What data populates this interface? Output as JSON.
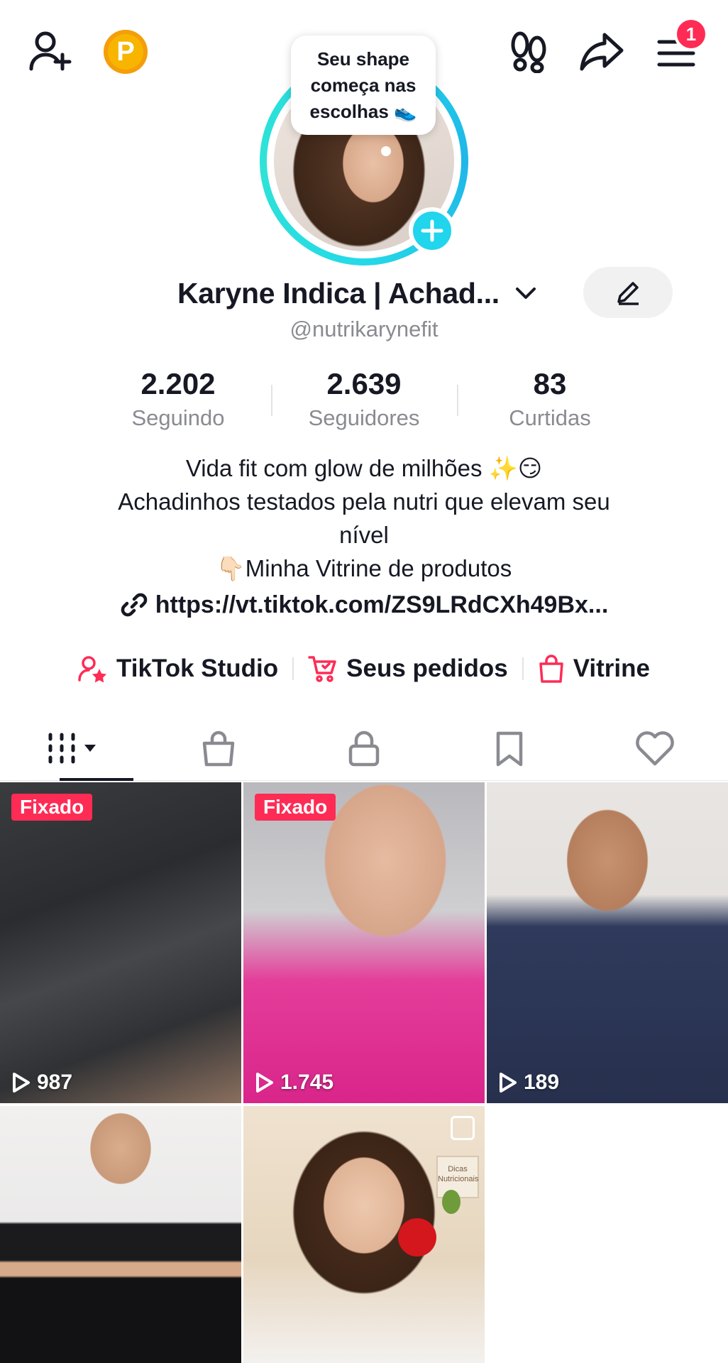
{
  "topbar": {
    "points_letter": "P",
    "notification_count": "1",
    "icons": [
      "add-user-icon",
      "points-icon",
      "footprints-icon",
      "share-icon",
      "menu-icon"
    ]
  },
  "profile": {
    "bubble_text": "Seu shape começa nas escolhas 👟",
    "display_name": "Karyne Indica | Achad...",
    "username": "@nutrikarynefit"
  },
  "stats": [
    {
      "value": "2.202",
      "label": "Seguindo"
    },
    {
      "value": "2.639",
      "label": "Seguidores"
    },
    {
      "value": "83",
      "label": "Curtidas"
    }
  ],
  "bio": {
    "line1": "Vida fit com glow de milhões ✨😏",
    "line2": "Achadinhos testados pela nutri que elevam seu",
    "line3": "nível",
    "line4": "👇🏻Minha Vitrine de produtos",
    "link": "https://vt.tiktok.com/ZS9LRdCXh49Bx..."
  },
  "actions": [
    {
      "label": "TikTok Studio",
      "icon": "studio-icon"
    },
    {
      "label": "Seus pedidos",
      "icon": "cart-icon"
    },
    {
      "label": "Vitrine",
      "icon": "bag-icon"
    }
  ],
  "tabs": [
    "videos-grid-icon",
    "shop-bag-icon",
    "lock-icon",
    "bookmark-icon",
    "heart-icon"
  ],
  "videos": [
    {
      "pinned_label": "Fixado",
      "views": "987"
    },
    {
      "pinned_label": "Fixado",
      "views": "1.745"
    },
    {
      "pinned_label": "",
      "views": "189"
    },
    {
      "pinned_label": "",
      "views": ""
    },
    {
      "pinned_label": "",
      "views": "",
      "sign_text": "Dicas Nutricionais"
    }
  ],
  "colors": {
    "accent": "#fe2c55",
    "avatar_ring": "#25d9e8",
    "points": "#f7b500",
    "text_muted": "#8a8b91"
  }
}
